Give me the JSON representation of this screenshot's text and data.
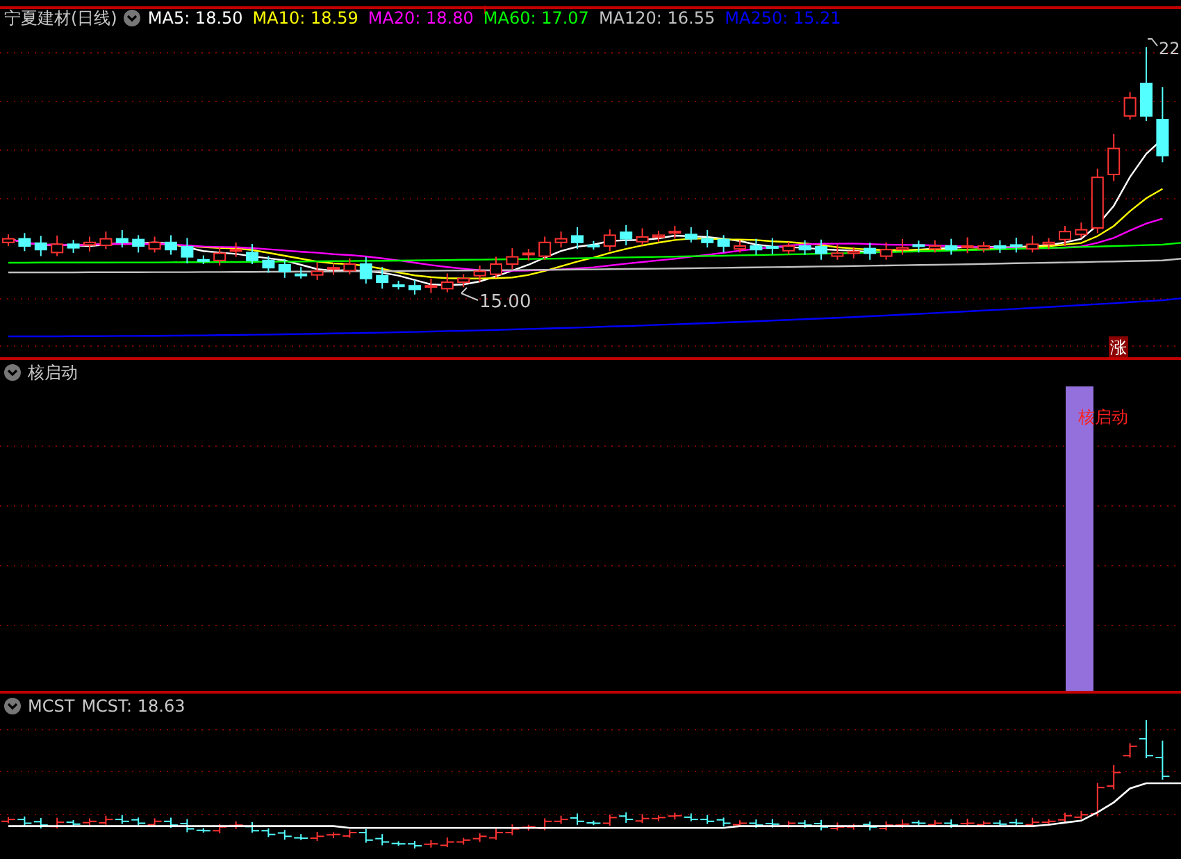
{
  "main_panel": {
    "title": "宁夏建材(日线)",
    "indicators": [
      {
        "label": "MA5: 18.50",
        "color": "#ffffff"
      },
      {
        "label": "MA10: 18.59",
        "color": "#ffff00"
      },
      {
        "label": "MA20: 18.80",
        "color": "#ff00ff"
      },
      {
        "label": "MA60: 17.07",
        "color": "#00ff00"
      },
      {
        "label": "MA120: 16.55",
        "color": "#c0c0c0"
      },
      {
        "label": "MA250: 15.21",
        "color": "#0000ff"
      }
    ],
    "high_label": "22",
    "low_label": "15.00",
    "badge": "涨"
  },
  "signal_panel": {
    "title": "核启动",
    "signal_label": "核启动"
  },
  "cost_panel": {
    "title": "MCST",
    "value": "MCST: 18.63"
  }
}
